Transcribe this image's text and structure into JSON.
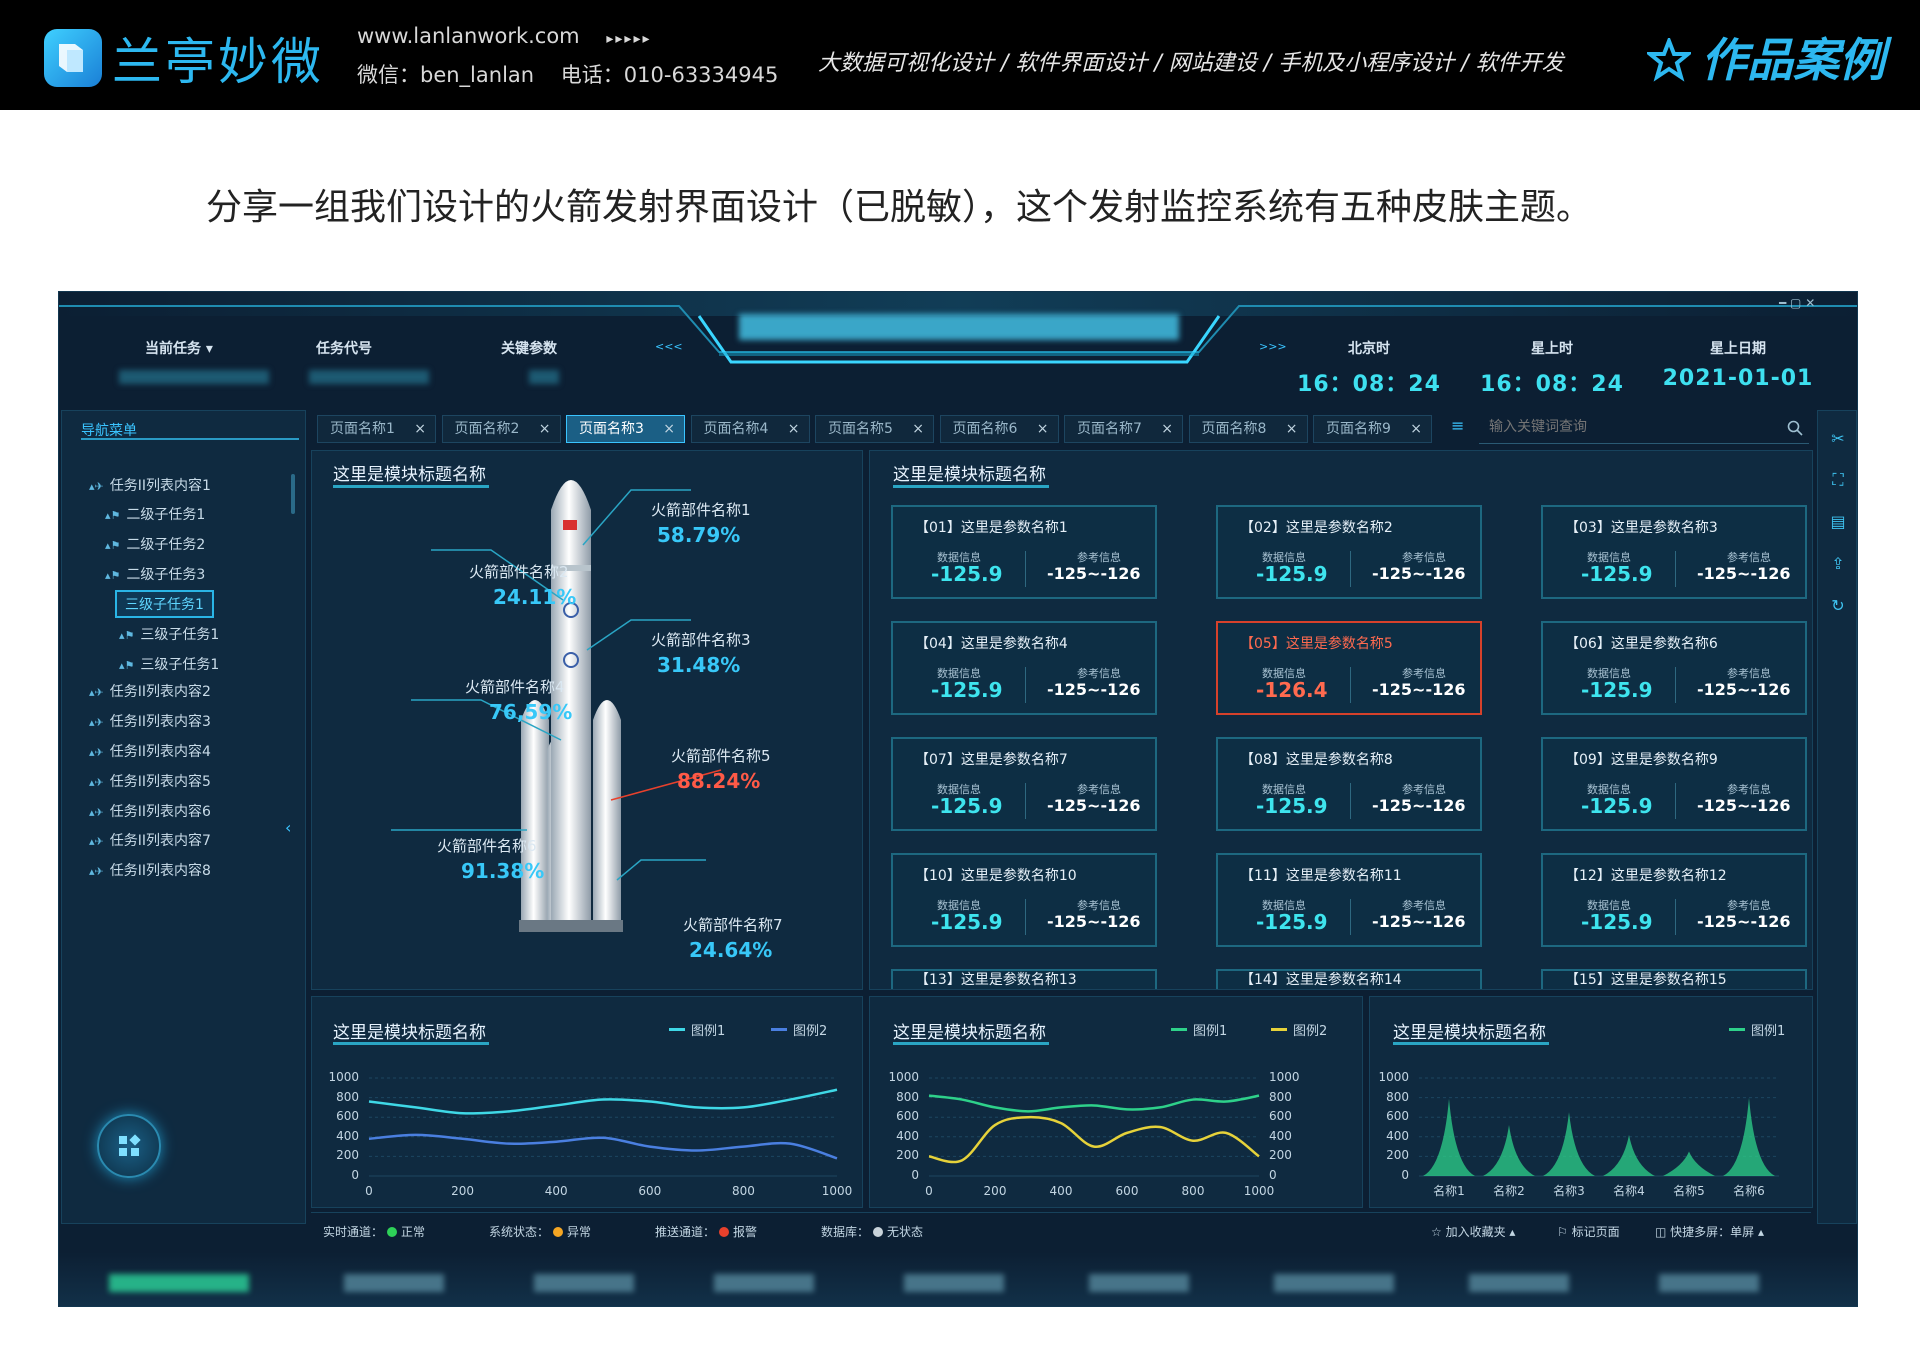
{
  "banner": {
    "brand": "兰亭妙微",
    "url": "www.lanlanwork.com",
    "url_arrows": "▸▸▸▸▸",
    "wechat": "微信：ben_lanlan",
    "phone": "电话：010-63334945",
    "services": "大数据可视化设计 / 软件界面设计 / 网站建设 / 手机及小程序设计 / 软件开发",
    "cases": "作品案例",
    "accent": "#2db8f0"
  },
  "intro": "分享一组我们设计的火箭发射界面设计（已脱敏），这个发射监控系统有五种皮肤主题。",
  "app": {
    "header": {
      "current_task": "当前任务 ▾",
      "task_code": "任务代号",
      "key_params": "关键参数",
      "left_arrows": "<<<",
      "right_arrows": ">>>",
      "beijing_label": "北京时",
      "star_label": "星上时",
      "star_date_label": "星上日期",
      "beijing_time": "16：08：24",
      "star_time": "16：08：24",
      "star_date": "2021-01-01"
    },
    "nav_title": "导航菜单",
    "tabs": [
      "页面名称1",
      "页面名称2",
      "页面名称3",
      "页面名称4",
      "页面名称5",
      "页面名称6",
      "页面名称7",
      "页面名称8",
      "页面名称9"
    ],
    "active_tab": 2,
    "search_placeholder": "输入关键词查询",
    "tree": [
      {
        "label": "任务II列表内容1",
        "level": 0
      },
      {
        "label": "二级子任务1",
        "level": 1
      },
      {
        "label": "二级子任务2",
        "level": 1
      },
      {
        "label": "二级子任务3",
        "level": 1
      },
      {
        "label": "三级子任务1",
        "level": 2,
        "selected": true
      },
      {
        "label": "三级子任务1",
        "level": 2
      },
      {
        "label": "三级子任务1",
        "level": 2
      },
      {
        "label": "任务II列表内容2",
        "level": 0
      },
      {
        "label": "任务II列表内容3",
        "level": 0
      },
      {
        "label": "任务II列表内容4",
        "level": 0
      },
      {
        "label": "任务II列表内容5",
        "level": 0
      },
      {
        "label": "任务II列表内容6",
        "level": 0
      },
      {
        "label": "任务II列表内容7",
        "level": 0
      },
      {
        "label": "任务II列表内容8",
        "level": 0
      }
    ],
    "module_title": "这里是模块标题名称",
    "rocket_parts": [
      {
        "label": "火箭部件名称1",
        "value": "58.79%"
      },
      {
        "label": "火箭部件名称2",
        "value": "24.11%"
      },
      {
        "label": "火箭部件名称3",
        "value": "31.48%"
      },
      {
        "label": "火箭部件名称4",
        "value": "76,59%"
      },
      {
        "label": "火箭部件名称5",
        "value": "88.24%"
      },
      {
        "label": "火箭部件名称6",
        "value": "91.38%"
      },
      {
        "label": "火箭部件名称7",
        "value": "24.64%"
      }
    ],
    "card_data_label": "数据信息",
    "card_ref_label": "参考信息",
    "cards": [
      {
        "name": "【01】这里是参数名称1",
        "value": "-125.9",
        "ref": "-125~-126"
      },
      {
        "name": "【02】这里是参数名称2",
        "value": "-125.9",
        "ref": "-125~-126"
      },
      {
        "name": "【03】这里是参数名称3",
        "value": "-125.9",
        "ref": "-125~-126"
      },
      {
        "name": "【04】这里是参数名称4",
        "value": "-125.9",
        "ref": "-125~-126"
      },
      {
        "name": "【05】这里是参数名称5",
        "value": "-126.4",
        "ref": "-125~-126",
        "warn": true
      },
      {
        "name": "【06】这里是参数名称6",
        "value": "-125.9",
        "ref": "-125~-126"
      },
      {
        "name": "【07】这里是参数名称7",
        "value": "-125.9",
        "ref": "-125~-126"
      },
      {
        "name": "【08】这里是参数名称8",
        "value": "-125.9",
        "ref": "-125~-126"
      },
      {
        "name": "【09】这里是参数名称9",
        "value": "-125.9",
        "ref": "-125~-126"
      },
      {
        "name": "【10】这里是参数名称10",
        "value": "-125.9",
        "ref": "-125~-126"
      },
      {
        "name": "【11】这里是参数名称11",
        "value": "-125.9",
        "ref": "-125~-126"
      },
      {
        "name": "【12】这里是参数名称12",
        "value": "-125.9",
        "ref": "-125~-126"
      },
      {
        "name": "【13】这里是参数名称13",
        "value": "",
        "ref": ""
      },
      {
        "name": "【14】这里是参数名称14",
        "value": "",
        "ref": ""
      },
      {
        "name": "【15】这里是参数名称15",
        "value": "",
        "ref": ""
      }
    ],
    "status": {
      "realtime": "实时通道：",
      "realtime_state": "正常",
      "system": "系统状态：",
      "system_state": "异常",
      "push": "推送通道：",
      "push_state": "报警",
      "db": "数据库：",
      "db_state": "无状态",
      "favorite": "☆ 加入收藏夹 ▴",
      "mark": "⚐ 标记页面",
      "split": "◫ 快捷多屏：单屏 ▴",
      "colors": {
        "ok": "#2ed158",
        "warn": "#f5a623",
        "alarm": "#e8412c",
        "none": "#c9d3da"
      }
    }
  },
  "chart_data": [
    {
      "type": "line",
      "title": "这里是模块标题名称",
      "x": [
        0,
        100,
        200,
        300,
        400,
        500,
        600,
        700,
        800,
        900,
        1000
      ],
      "series": [
        {
          "name": "图例1",
          "color": "#3fd8e6",
          "values": [
            760,
            700,
            640,
            660,
            720,
            780,
            760,
            700,
            700,
            780,
            880
          ]
        },
        {
          "name": "图例2",
          "color": "#4a7fe0",
          "values": [
            380,
            420,
            380,
            330,
            350,
            390,
            300,
            260,
            300,
            330,
            180
          ]
        }
      ],
      "xticks": [
        0,
        200,
        400,
        600,
        800,
        1000
      ],
      "ylim": [
        0,
        1000
      ],
      "yticks": [
        0,
        200,
        400,
        600,
        800,
        1000
      ]
    },
    {
      "type": "line",
      "title": "这里是模块标题名称",
      "x": [
        0,
        100,
        200,
        300,
        400,
        500,
        600,
        700,
        800,
        900,
        1000
      ],
      "series": [
        {
          "name": "图例1",
          "color": "#2ed18a",
          "values": [
            820,
            780,
            700,
            660,
            700,
            720,
            680,
            700,
            780,
            760,
            820
          ]
        },
        {
          "name": "图例2",
          "color": "#e6d23a",
          "values": [
            200,
            160,
            520,
            600,
            540,
            300,
            440,
            500,
            360,
            440,
            200
          ]
        }
      ],
      "xticks": [
        0,
        200,
        400,
        600,
        800,
        1000
      ],
      "ylim": [
        0,
        1000
      ],
      "yticks": [
        0,
        200,
        400,
        600,
        800,
        1000
      ],
      "y2ticks": [
        0,
        200,
        400,
        600,
        800,
        1000
      ]
    },
    {
      "type": "area",
      "title": "这里是模块标题名称",
      "categories": [
        "名称1",
        "名称2",
        "名称3",
        "名称4",
        "名称5",
        "名称6"
      ],
      "series": [
        {
          "name": "图例1",
          "color": "#2ed18a",
          "values": [
            790,
            520,
            650,
            420,
            250,
            800
          ]
        }
      ],
      "ylim": [
        0,
        1000
      ],
      "yticks": [
        0,
        200,
        400,
        600,
        800,
        1000
      ]
    }
  ]
}
